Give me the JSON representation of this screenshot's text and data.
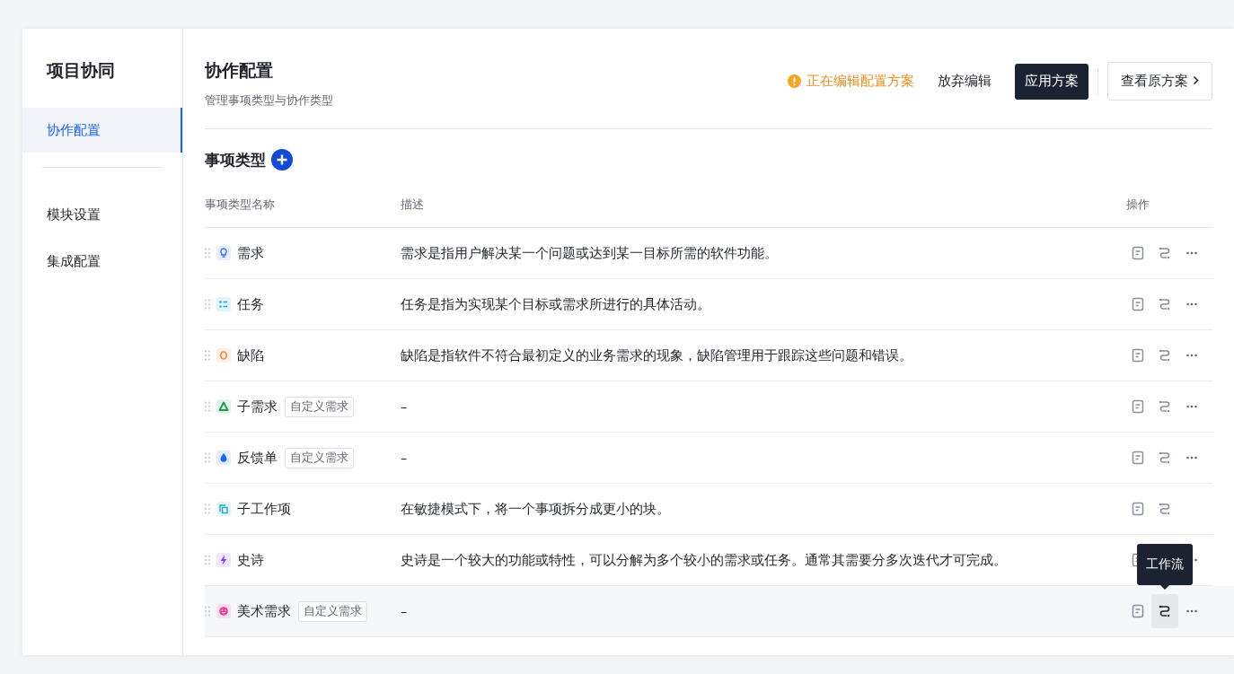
{
  "sidebar": {
    "title": "项目协同",
    "groups": [
      [
        {
          "label": "协作配置",
          "selected": true
        }
      ],
      [
        {
          "label": "模块设置",
          "selected": false
        },
        {
          "label": "集成配置",
          "selected": false
        }
      ]
    ]
  },
  "header": {
    "title": "协作配置",
    "subtitle": "管理事项类型与协作类型",
    "status": "正在编辑配置方案",
    "discard": "放弃编辑",
    "apply": "应用方案",
    "view_original": "查看原方案"
  },
  "section": {
    "title": "事项类型"
  },
  "table": {
    "columns": [
      "事项类型名称",
      "描述",
      "操作"
    ],
    "rows": [
      {
        "name": "需求",
        "kind": "bulb",
        "color": "#3370ff",
        "description": "需求是指用户解决某一个问题或达到某一目标所需的软件功能。",
        "has_more": true,
        "hovered": false
      },
      {
        "name": "任务",
        "kind": "list",
        "color": "#1aa3e8",
        "description": "任务是指为实现某个目标或需求所进行的具体活动。",
        "has_more": true,
        "hovered": false
      },
      {
        "name": "缺陷",
        "kind": "ring",
        "color": "#ff7d2e",
        "description": "缺陷是指软件不符合最初定义的业务需求的现象，缺陷管理用于跟踪这些问题和错误。",
        "has_more": true,
        "hovered": false
      },
      {
        "name": "子需求",
        "kind": "triangle",
        "color": "#1f9d55",
        "tag": "自定义需求",
        "description": "–",
        "has_more": true,
        "hovered": false
      },
      {
        "name": "反馈单",
        "kind": "drop",
        "color": "#1664ff",
        "tag": "自定义需求",
        "description": "–",
        "has_more": true,
        "hovered": false
      },
      {
        "name": "子工作项",
        "kind": "copy",
        "color": "#1ea7d6",
        "description": "在敏捷模式下，将一个事项拆分成更小的块。",
        "has_more": false,
        "hovered": false
      },
      {
        "name": "史诗",
        "kind": "bolt",
        "color": "#8a3ffc",
        "description": "史诗是一个较大的功能或特性，可以分解为多个较小的需求或任务。通常其需要分多次迭代才可完成。",
        "has_more": true,
        "hovered": false
      },
      {
        "name": "美术需求",
        "kind": "face",
        "color": "#f0409e",
        "tag": "自定义需求",
        "description": "–",
        "has_more": true,
        "hovered": true
      }
    ]
  },
  "tooltip": {
    "text": "工作流"
  }
}
